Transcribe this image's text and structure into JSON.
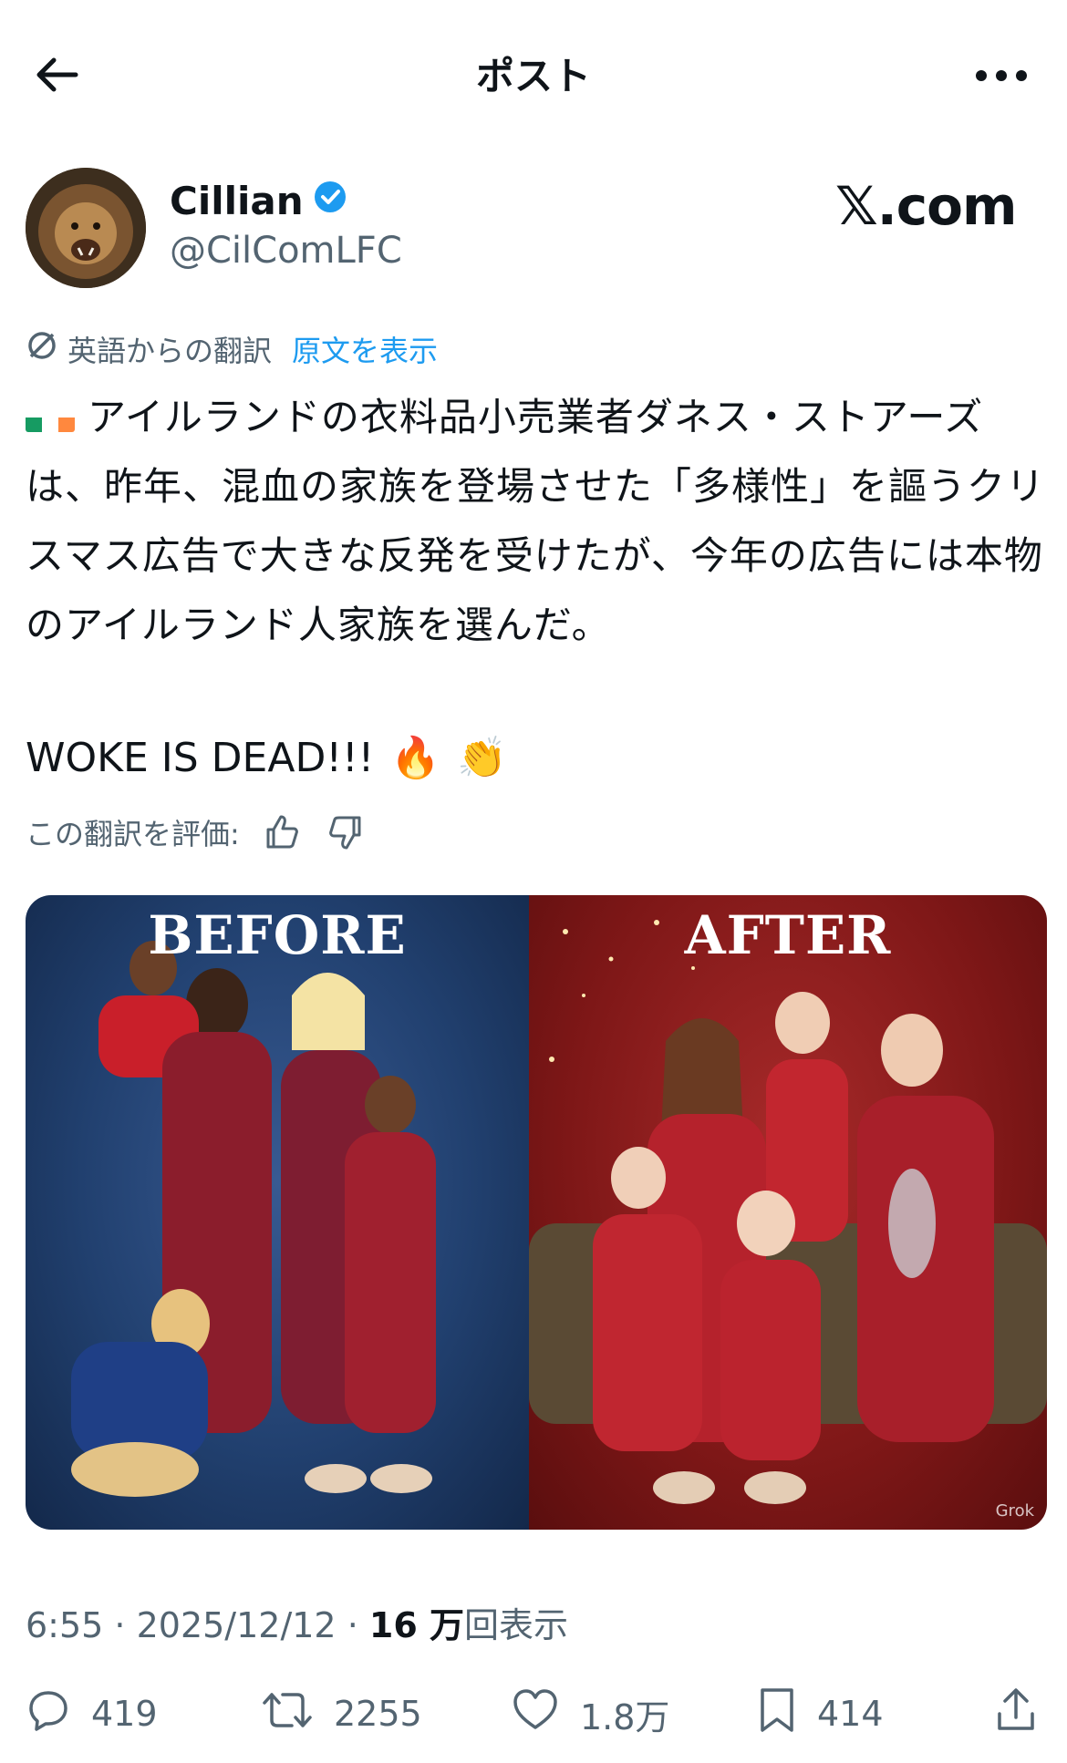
{
  "header": {
    "title": "ポスト"
  },
  "author": {
    "display_name": "Cillian",
    "handle": "@CilComLFC",
    "verified": true,
    "watermark": "𝕏.com"
  },
  "translation": {
    "label": "英語からの翻訳",
    "show_original": "原文を表示"
  },
  "post": {
    "text": "アイルランドの衣料品小売業者ダネス・ストアーズは、昨年、混血の家族を登場させた「多様性」を謳うクリスマス広告で大きな反発を受けたが、今年の広告には本物のアイルランド人家族を選んだ。",
    "line2": "WOKE IS DEAD!!!",
    "emoji_fire": "🔥",
    "emoji_clap": "👏",
    "flag_colors": [
      "#169b62",
      "#ffffff",
      "#ff883e"
    ]
  },
  "rating": {
    "label": "この翻訳を評価:"
  },
  "media": {
    "left_label": "BEFORE",
    "right_label": "AFTER",
    "watermark": "Grok"
  },
  "meta": {
    "time": "6:55",
    "date": "2025/12/12",
    "views_count": "16 万",
    "views_label": "回表示"
  },
  "actions": {
    "replies": "419",
    "reposts": "2255",
    "likes": "1.8万",
    "bookmarks": "414"
  },
  "colors": {
    "accent": "#1d9bf0",
    "secondary_text": "#536471",
    "primary_text": "#0f1419"
  }
}
